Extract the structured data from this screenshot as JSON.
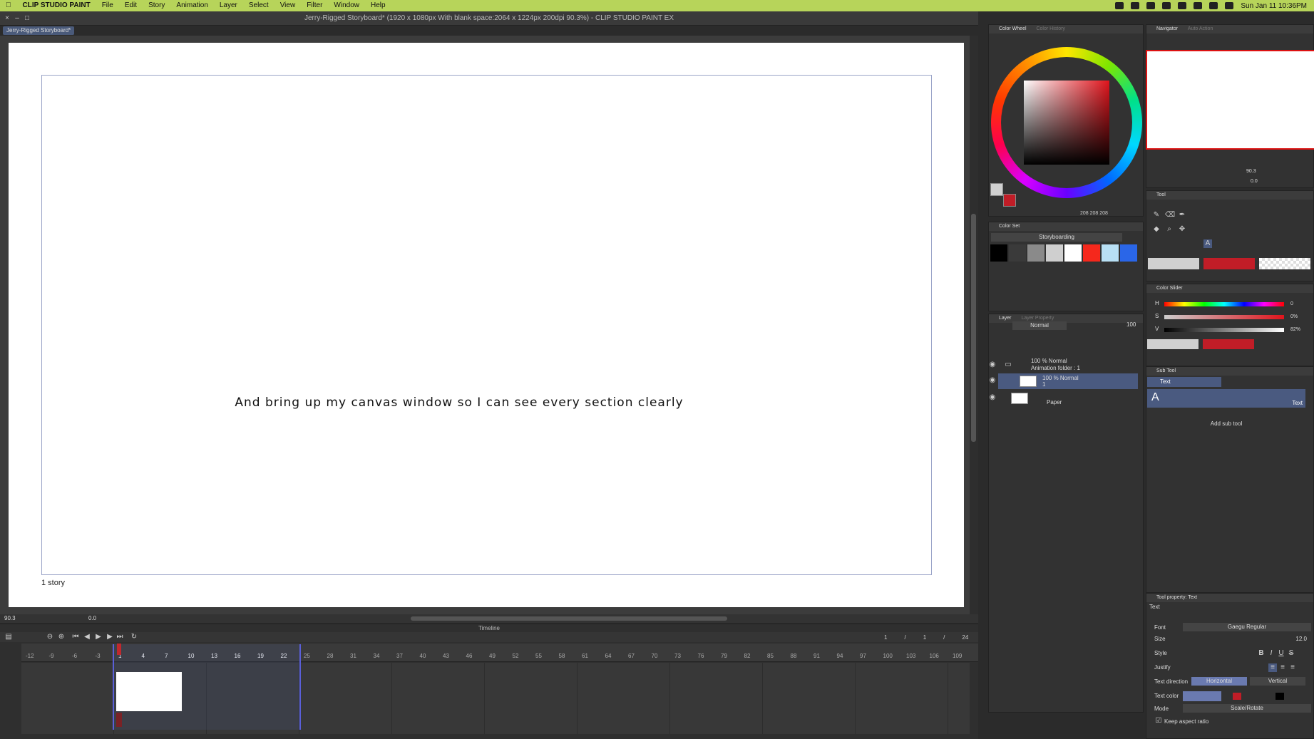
{
  "menubar": {
    "apple": "",
    "app": "CLIP STUDIO PAINT",
    "items": [
      "File",
      "Edit",
      "Story",
      "Animation",
      "Layer",
      "Select",
      "View",
      "Filter",
      "Window",
      "Help"
    ],
    "clock": "Sun Jan 11  10:36PM"
  },
  "window": {
    "title": "Jerry-Rigged Storyboard* (1920 x 1080px With blank space:2064 x 1224px 200dpi 90.3%)  - CLIP STUDIO PAINT EX",
    "tab": "Jerry-Rigged Storyboard*"
  },
  "canvas": {
    "caption": "And bring up my canvas window so I can see every section clearly",
    "story_label": "1 story",
    "zoom": "90.3",
    "rotation": "0.0"
  },
  "timeline": {
    "title": "Timeline",
    "counter": [
      "1",
      "/",
      "1",
      "/",
      "24"
    ],
    "ticks": [
      "-12",
      "-9",
      "-6",
      "-3",
      "1",
      "4",
      "7",
      "10",
      "13",
      "16",
      "19",
      "22",
      "25",
      "28",
      "31",
      "34",
      "37",
      "40",
      "43",
      "46",
      "49",
      "52",
      "55",
      "58",
      "61",
      "64",
      "67",
      "70",
      "73",
      "76",
      "79",
      "82",
      "85",
      "88",
      "91",
      "94",
      "97",
      "100",
      "103",
      "106",
      "109"
    ]
  },
  "panels": {
    "color_wheel": {
      "tab1": "Color Wheel",
      "tab2": "Color History",
      "rgb": "208 208 208"
    },
    "color_set": {
      "title": "Color Set",
      "set_name": "Storyboarding",
      "swatches": [
        "#000000",
        "#3a3a3a",
        "#8a8a8a",
        "#cfcfcf",
        "#ffffff",
        "#f5281c",
        "#b8e0f5",
        "#2a66e8"
      ]
    },
    "layer": {
      "tab1": "Layer",
      "tab2": "Layer Property",
      "blend": "Normal",
      "opacity": "100",
      "rows": [
        {
          "line1": "100 % Normal",
          "line2": "Animation folder : 1"
        },
        {
          "line1": "100 % Normal",
          "line2": "1"
        },
        {
          "line1": "Paper",
          "line2": ""
        }
      ]
    },
    "navigator": {
      "tab1": "Navigator",
      "tab2": "Auto Action",
      "zoom": "90.3",
      "rotation": "0.0"
    },
    "tool": {
      "title": "Tool"
    },
    "color_slider": {
      "title": "Color Slider",
      "h_label": "H",
      "s_label": "S",
      "v_label": "V",
      "h": "0",
      "s": "0%",
      "v": "82%",
      "mode": "HSV"
    },
    "sub_tool": {
      "title": "Sub Tool",
      "item": "Text",
      "big_label": "Text",
      "add": "Add sub tool"
    },
    "tool_property": {
      "title": "Tool property: Text",
      "subtitle": "Text",
      "font_label": "Font",
      "font": "Gaegu Regular",
      "size_label": "Size",
      "size": "12.0",
      "style_label": "Style",
      "justify_label": "Justify",
      "direction_label": "Text direction",
      "horizontal": "Horizontal",
      "vertical": "Vertical",
      "color_label": "Text color",
      "mode_label": "Mode",
      "mode": "Scale/Rotate",
      "keep_aspect": "Keep aspect ratio"
    }
  }
}
